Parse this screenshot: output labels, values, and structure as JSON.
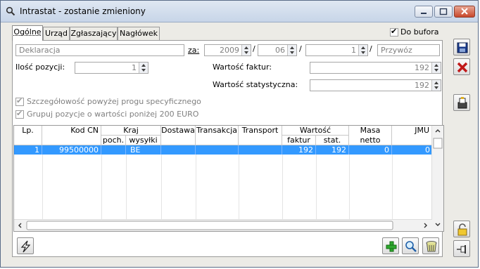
{
  "window": {
    "title": "Intrastat - zostanie zmieniony"
  },
  "tabs": [
    {
      "label": "Ogólne"
    },
    {
      "label": "Urząd"
    },
    {
      "label": "Zgłaszający"
    },
    {
      "label": "Nagłówek"
    }
  ],
  "do_bufora": {
    "label": "Do bufora",
    "checked": true
  },
  "header": {
    "deklaracja": "Deklaracja",
    "za_label": "za:",
    "year": "2009",
    "month": "06",
    "number": "1",
    "przywoz": "Przywóz",
    "slash": "/"
  },
  "ilosc_pozycji": {
    "label": "Ilość pozycji:",
    "value": "1"
  },
  "wartosc_faktur": {
    "label": "Wartość faktur:",
    "value": "192"
  },
  "wartosc_statystyczna": {
    "label": "Wartość statystyczna:",
    "value": "192"
  },
  "options": {
    "szczegolowosc": {
      "label": "Szczegółowość powyżej progu specyficznego",
      "checked": true
    },
    "grupuj": {
      "label": "Grupuj pozycje o wartości poniżej 200 EURO",
      "checked": true
    }
  },
  "grid": {
    "columns": {
      "lp": "Lp.",
      "kod_cn": "Kod CN",
      "kraj": "Kraj",
      "poch": "poch.",
      "wysylki": "wysyłki",
      "dostawa": "Dostawa",
      "transakcja": "Transakcja",
      "transport": "Transport",
      "wartosc": "Wartość",
      "faktur": "faktur",
      "stat": "stat.",
      "masa_netto": "Masa netto",
      "jmu": "JMU"
    },
    "rows": [
      {
        "lp": "1",
        "kod_cn": "99500000",
        "poch": "",
        "wysylki": "BE",
        "dostawa": "",
        "transakcja": "",
        "transport": "",
        "faktur": "192",
        "stat": "192",
        "masa_netto": "0",
        "jmu": "0"
      }
    ]
  }
}
